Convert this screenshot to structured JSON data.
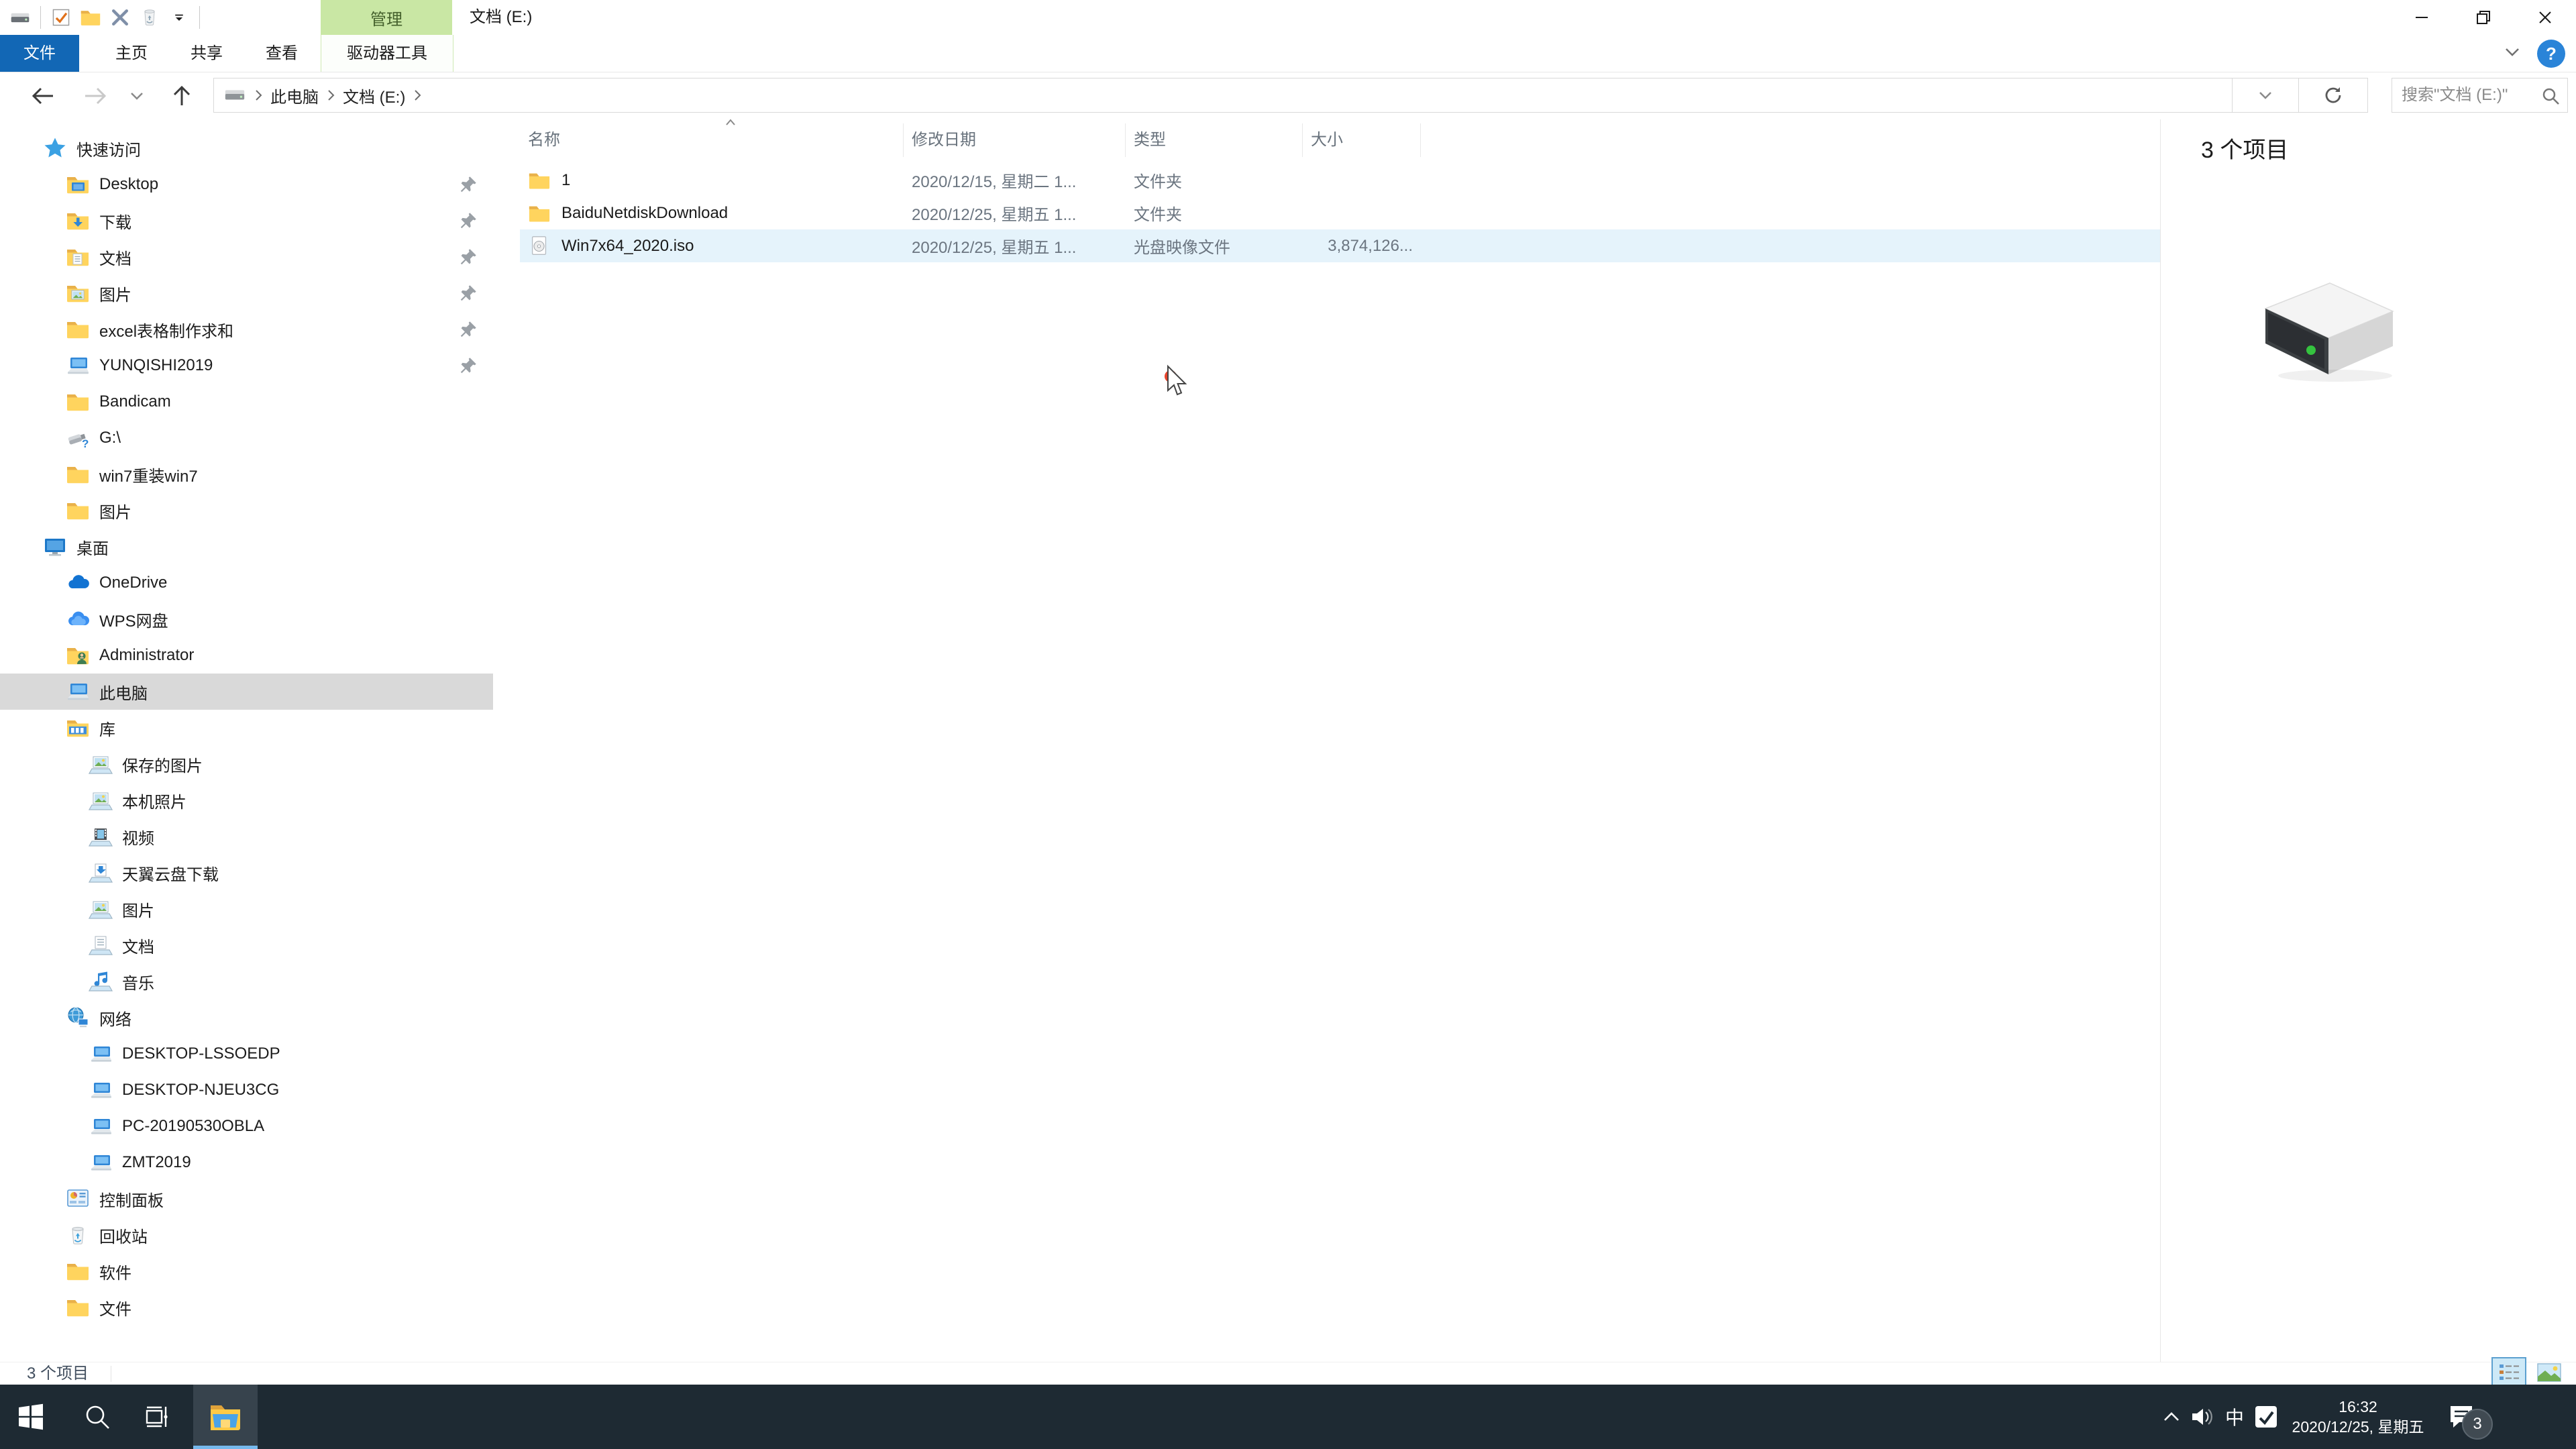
{
  "colors": {
    "accent_blue": "#1267b5",
    "context_green_bg": "#c9e7a4",
    "context_green_text": "#44602c",
    "selection_gray": "#d9d9d9",
    "row_hover_blue": "#e5f3fb",
    "taskbar_bg": "#1e2a33",
    "taskbar_underline": "#76b9ed"
  },
  "titlebar": {
    "window_title": "文档 (E:)",
    "context_tab_group_label": "管理",
    "qat_icons": [
      "drive-small",
      "checkbox",
      "folder",
      "delete",
      "recycle-small",
      "dropdown"
    ]
  },
  "ribbon": {
    "tabs": [
      {
        "id": "file",
        "label": "文件",
        "active": true
      },
      {
        "id": "home",
        "label": "主页"
      },
      {
        "id": "share",
        "label": "共享"
      },
      {
        "id": "view",
        "label": "查看"
      },
      {
        "id": "drive-tools",
        "label": "驱动器工具",
        "contextual": true
      }
    ],
    "help_label": "?"
  },
  "navbar": {
    "breadcrumb": [
      {
        "id": "this-pc",
        "label": "此电脑"
      },
      {
        "id": "docs-e",
        "label": "文档 (E:)"
      }
    ],
    "search_placeholder": "搜索\"文档 (E:)\""
  },
  "sidebar": {
    "items": [
      {
        "id": "quick-access",
        "label": "快速访问",
        "icon": "star",
        "level": 0
      },
      {
        "id": "desktop-folder",
        "label": "Desktop",
        "icon": "folder-desktop",
        "level": 1,
        "pinned": true
      },
      {
        "id": "downloads",
        "label": "下载",
        "icon": "folder-download",
        "level": 1,
        "pinned": true
      },
      {
        "id": "documents",
        "label": "文档",
        "icon": "folder-documents",
        "level": 1,
        "pinned": true
      },
      {
        "id": "pictures",
        "label": "图片",
        "icon": "folder-pictures",
        "level": 1,
        "pinned": true
      },
      {
        "id": "excel-folder",
        "label": "excel表格制作求和",
        "icon": "folder",
        "level": 1,
        "pinned": true
      },
      {
        "id": "yunqishi2019",
        "label": "YUNQISHI2019",
        "icon": "computer",
        "level": 1,
        "pinned": true
      },
      {
        "id": "bandicam",
        "label": "Bandicam",
        "icon": "folder",
        "level": 1
      },
      {
        "id": "g-drive",
        "label": "G:\\",
        "icon": "usb-drive",
        "level": 1
      },
      {
        "id": "win7-folder",
        "label": "win7重装win7",
        "icon": "folder",
        "level": 1
      },
      {
        "id": "pictures2",
        "label": "图片",
        "icon": "folder",
        "level": 1
      },
      {
        "id": "desktop-root",
        "label": "桌面",
        "icon": "desktop-monitor",
        "level": 0
      },
      {
        "id": "onedrive",
        "label": "OneDrive",
        "icon": "onedrive",
        "level": 1
      },
      {
        "id": "wps-cloud",
        "label": "WPS网盘",
        "icon": "wps-cloud",
        "level": 1
      },
      {
        "id": "administrator",
        "label": "Administrator",
        "icon": "user-folder",
        "level": 1
      },
      {
        "id": "this-pc",
        "label": "此电脑",
        "icon": "computer",
        "level": 1,
        "selected": true
      },
      {
        "id": "libraries",
        "label": "库",
        "icon": "library",
        "level": 1
      },
      {
        "id": "saved-pictures",
        "label": "保存的图片",
        "icon": "lib-pictures",
        "level": 2
      },
      {
        "id": "camera-roll",
        "label": "本机照片",
        "icon": "lib-pictures",
        "level": 2
      },
      {
        "id": "videos",
        "label": "视频",
        "icon": "lib-videos",
        "level": 2
      },
      {
        "id": "tianyi-download",
        "label": "天翼云盘下载",
        "icon": "lib-download",
        "level": 2
      },
      {
        "id": "lib-pictures",
        "label": "图片",
        "icon": "lib-pictures",
        "level": 2
      },
      {
        "id": "lib-documents",
        "label": "文档",
        "icon": "lib-documents",
        "level": 2
      },
      {
        "id": "music",
        "label": "音乐",
        "icon": "lib-music",
        "level": 2
      },
      {
        "id": "network",
        "label": "网络",
        "icon": "network",
        "level": 1
      },
      {
        "id": "desktop-lssoedp",
        "label": "DESKTOP-LSSOEDP",
        "icon": "network-pc",
        "level": 2
      },
      {
        "id": "desktop-njeu3cg",
        "label": "DESKTOP-NJEU3CG",
        "icon": "network-pc",
        "level": 2
      },
      {
        "id": "pc-20190530obla",
        "label": "PC-20190530OBLA",
        "icon": "network-pc",
        "level": 2
      },
      {
        "id": "zmt2019",
        "label": "ZMT2019",
        "icon": "network-pc",
        "level": 2
      },
      {
        "id": "control-panel",
        "label": "控制面板",
        "icon": "control-panel",
        "level": 1
      },
      {
        "id": "recycle-bin",
        "label": "回收站",
        "icon": "recycle-bin",
        "level": 1
      },
      {
        "id": "software",
        "label": "软件",
        "icon": "folder",
        "level": 1
      },
      {
        "id": "files",
        "label": "文件",
        "icon": "folder",
        "level": 1
      }
    ]
  },
  "files": {
    "columns": [
      {
        "id": "name",
        "label": "名称"
      },
      {
        "id": "date",
        "label": "修改日期"
      },
      {
        "id": "type",
        "label": "类型"
      },
      {
        "id": "size",
        "label": "大小"
      }
    ],
    "sort_column": "名称",
    "sort_ascending": true,
    "rows": [
      {
        "icon": "folder",
        "name": "1",
        "date": "2020/12/15, 星期二 1...",
        "type": "文件夹",
        "size": ""
      },
      {
        "icon": "folder",
        "name": "BaiduNetdiskDownload",
        "date": "2020/12/25, 星期五 1...",
        "type": "文件夹",
        "size": ""
      },
      {
        "icon": "disc",
        "name": "Win7x64_2020.iso",
        "date": "2020/12/25, 星期五 1...",
        "type": "光盘映像文件",
        "size": "3,874,126...",
        "hover": true
      }
    ]
  },
  "preview": {
    "item_count": "3 个项目"
  },
  "statusbar": {
    "item_count": "3 个项目"
  },
  "taskbar": {
    "ime_label": "中",
    "clock_time": "16:32",
    "clock_date": "2020/12/25, 星期五",
    "notification_badge": "3"
  }
}
